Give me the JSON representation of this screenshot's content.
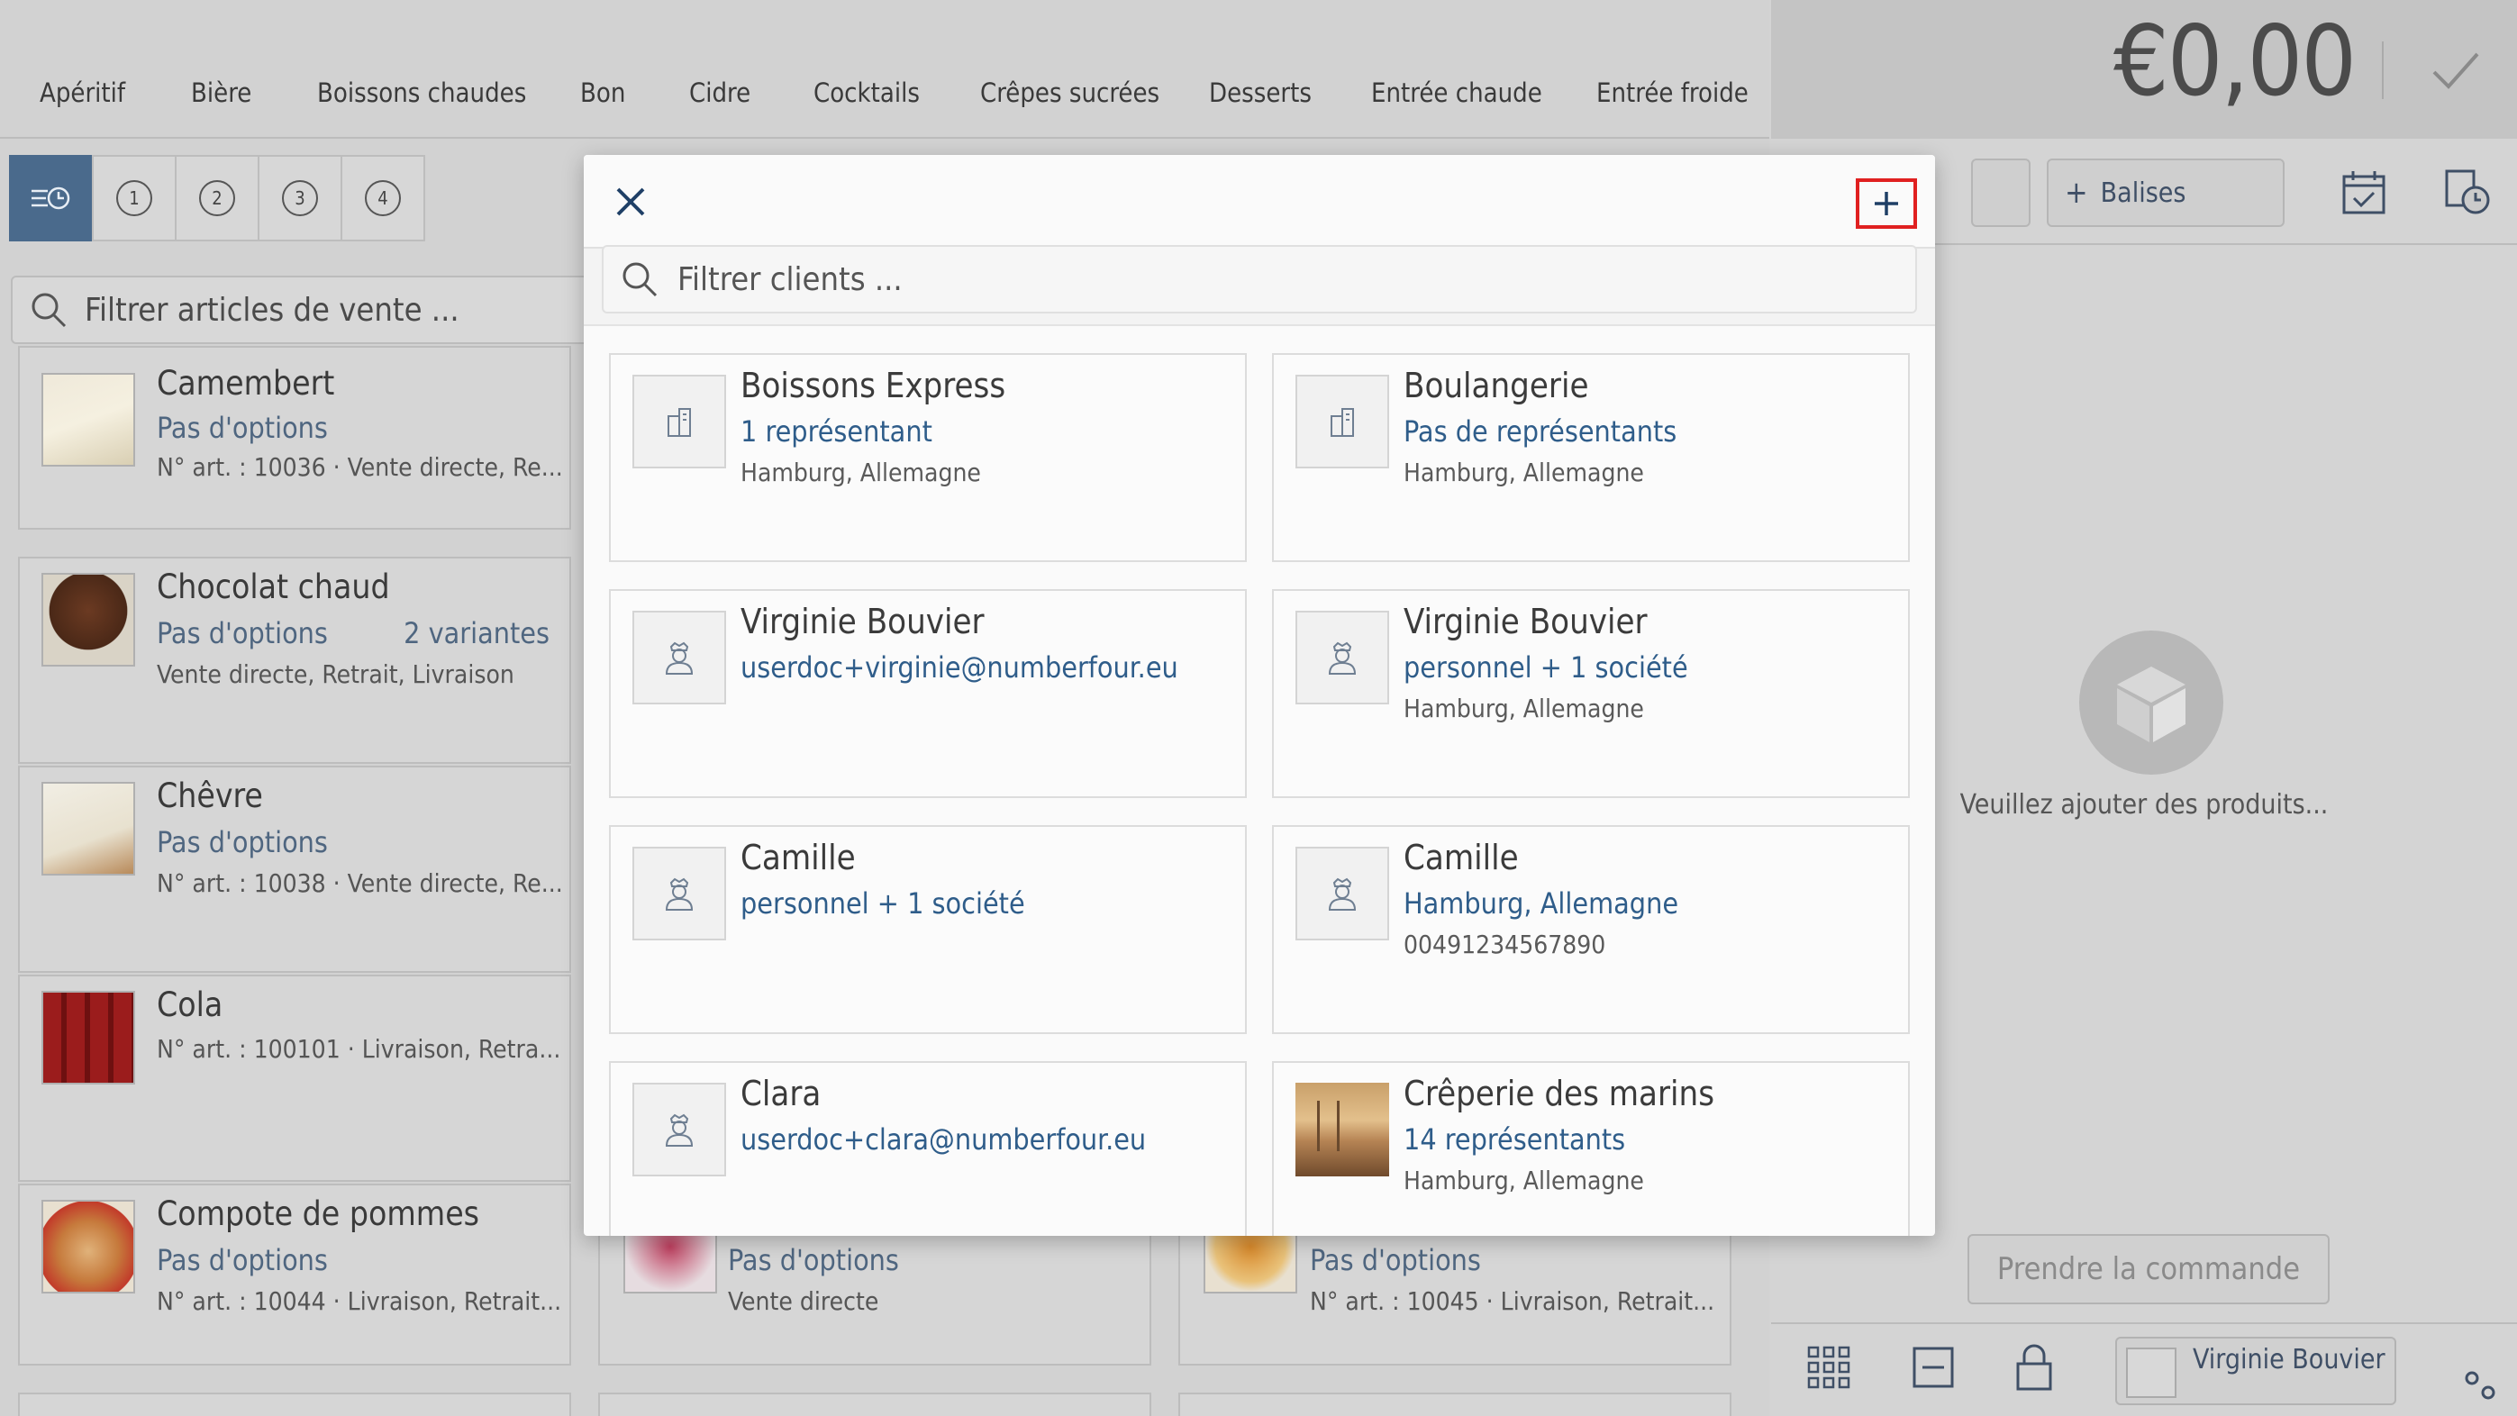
{
  "categories": [
    "Apéritif",
    "Bière",
    "Boissons chaudes",
    "Bon",
    "Cidre",
    "Cocktails",
    "Crêpes sucrées",
    "Desserts",
    "Entrée chaude",
    "Entrée froide"
  ],
  "tabs": [
    "1",
    "2",
    "3",
    "4"
  ],
  "left_search": {
    "placeholder": "Filtrer articles de vente ..."
  },
  "products": [
    {
      "name": "Camembert",
      "options": "Pas d'options",
      "variants": "",
      "info": "N° art. : 10036 · Vente directe, Re..."
    },
    {
      "name": "Chocolat chaud",
      "options": "Pas d'options",
      "variants": "2 variantes",
      "info": "Vente directe, Retrait, Livraison"
    },
    {
      "name": "Chêvre",
      "options": "Pas d'options",
      "variants": "",
      "info": "N° art. : 10038 · Vente directe, Re..."
    },
    {
      "name": "Cola",
      "options": "",
      "variants": "",
      "info": "N° art. : 100101 · Livraison, Retra..."
    },
    {
      "name": "Compote de pommes",
      "options": "Pas d'options",
      "variants": "",
      "info": "N° art. : 10044 · Livraison, Retrait..."
    },
    {
      "name": "",
      "options": "Pas d'options",
      "variants": "",
      "info": "Vente directe"
    },
    {
      "name": "",
      "options": "Pas d'options",
      "variants": "",
      "info": "N° art. : 10045 · Livraison, Retrait..."
    }
  ],
  "order": {
    "total": "€0,00",
    "tags_label": "Balises",
    "empty_text": "Veuillez ajouter des produits...",
    "take_order_label": "Prendre la commande",
    "current_user": "Virginie Bouvier"
  },
  "modal": {
    "search_placeholder": "Filtrer clients ...",
    "clients": [
      {
        "name": "Boissons Express",
        "line1": "1 représentant",
        "line2": "Hamburg, Allemagne",
        "kind": "company"
      },
      {
        "name": "Boulangerie",
        "line1": "Pas de représentants",
        "line2": "Hamburg, Allemagne",
        "kind": "company"
      },
      {
        "name": "Virginie Bouvier",
        "line1": "userdoc+virginie@numberfour.eu",
        "line2": "",
        "kind": "person"
      },
      {
        "name": "Virginie Bouvier",
        "line1": "personnel + 1 société",
        "line2": "Hamburg, Allemagne",
        "kind": "person"
      },
      {
        "name": "Camille",
        "line1": "personnel + 1 société",
        "line2": "",
        "kind": "person"
      },
      {
        "name": "Camille",
        "line1": "Hamburg, Allemagne",
        "line2": "00491234567890",
        "kind": "person"
      },
      {
        "name": "Clara",
        "line1": "userdoc+clara@numberfour.eu",
        "line2": "",
        "kind": "person"
      },
      {
        "name": "Crêperie des marins",
        "line1": "14 représentants",
        "line2": "Hamburg, Allemagne",
        "kind": "photo"
      }
    ]
  },
  "colors": {
    "accent": "#2f5d8a",
    "highlight": "#e02020",
    "active_tab": "#4a6a8c"
  }
}
